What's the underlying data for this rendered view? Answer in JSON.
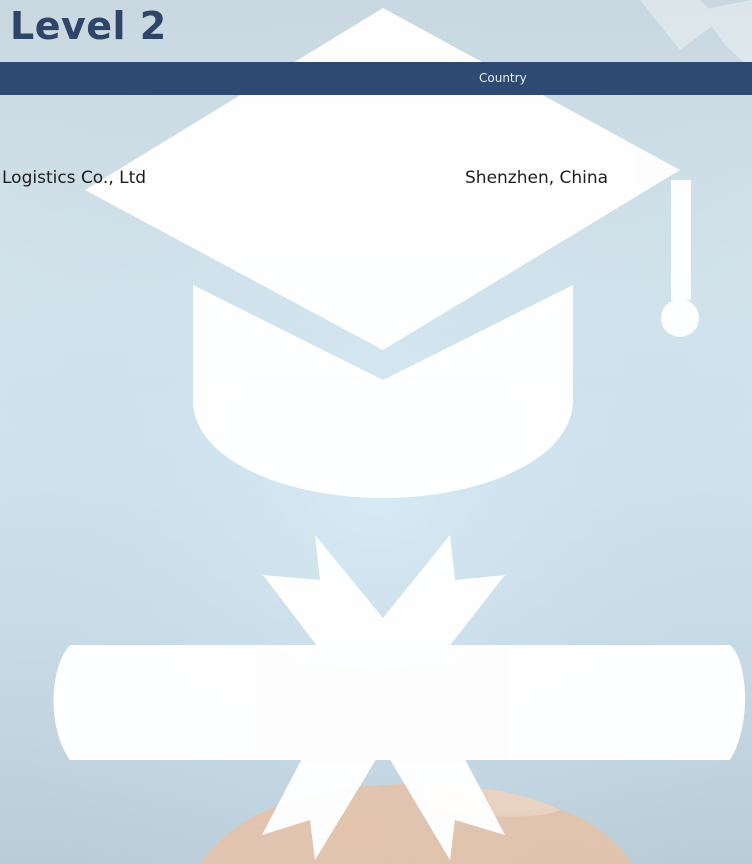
{
  "page": {
    "title": "Level 2"
  },
  "table": {
    "columns": [
      {
        "key": "company",
        "label": ""
      },
      {
        "key": "country",
        "label": "Country"
      }
    ],
    "rows": [
      {
        "company": "Logistics Co., Ltd",
        "country": "Shenzhen, China"
      }
    ]
  },
  "background": {
    "icons": [
      "graduation-cap-icon",
      "diploma-scroll-icon"
    ],
    "colors": {
      "header_bar": "#2f4a72",
      "title": "#2e4468",
      "icon_fill": "#ffffff"
    }
  }
}
